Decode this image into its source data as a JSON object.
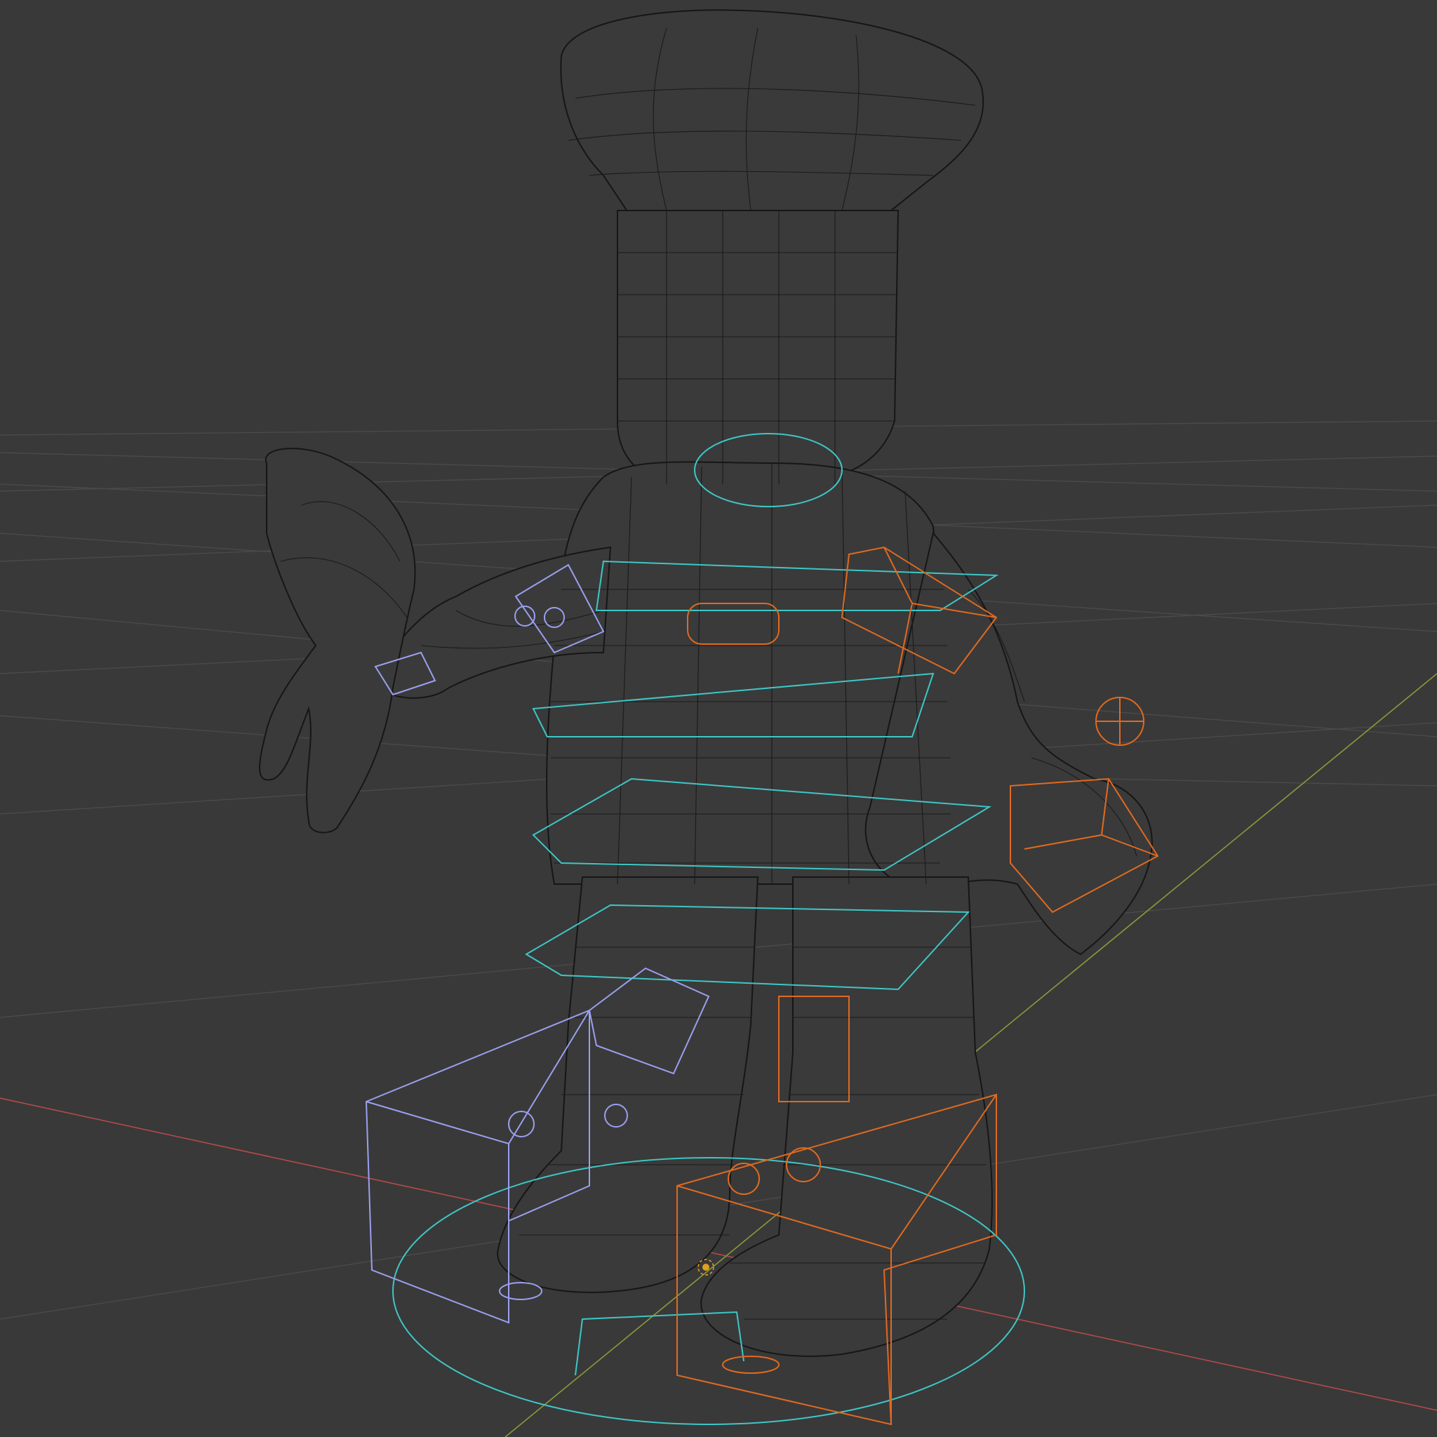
{
  "viewport": {
    "mode": "wireframe",
    "background_color": "#393939",
    "grid_color": "#4a4a4a",
    "mesh_wire_color": "#1a1a1a",
    "x_axis_color": "#b34a4a",
    "y_axis_color": "#8a9a3a"
  },
  "rig": {
    "control_color_center": "#3fc6c6",
    "control_color_left": "#e06a20",
    "control_color_right": "#9aa0ef"
  },
  "scene_object": {
    "name_hint": "chef-character-mesh"
  }
}
